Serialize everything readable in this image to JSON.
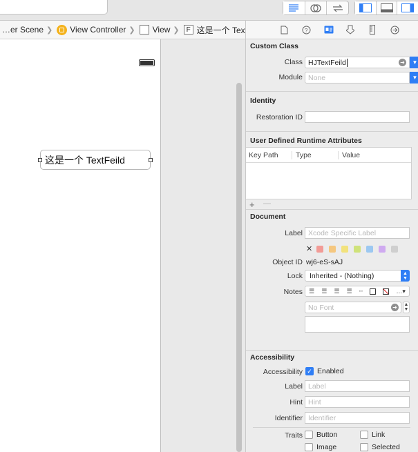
{
  "breadcrumbs": [
    {
      "label": "…er Scene"
    },
    {
      "label": "View Controller"
    },
    {
      "label": "View"
    },
    {
      "label": "这是一个 TextFeild",
      "prefix": "F"
    }
  ],
  "canvas": {
    "textfield_text": "这是一个 TextFeild"
  },
  "inspector": {
    "custom_class": {
      "title": "Custom Class",
      "class_label": "Class",
      "class_value": "HJTextFeild",
      "module_label": "Module",
      "module_value": "None"
    },
    "identity": {
      "title": "Identity",
      "restoration_label": "Restoration ID",
      "restoration_value": ""
    },
    "udra": {
      "title": "User Defined Runtime Attributes",
      "col_key": "Key Path",
      "col_type": "Type",
      "col_value": "Value",
      "add": "+",
      "remove": "—"
    },
    "document": {
      "title": "Document",
      "label_label": "Label",
      "label_placeholder": "Xcode Specific Label",
      "object_id_label": "Object ID",
      "object_id_value": "wj6-eS-sAJ",
      "lock_label": "Lock",
      "lock_value": "Inherited - (Nothing)",
      "notes_label": "Notes",
      "font_placeholder": "No Font",
      "swatches": [
        "#f29b96",
        "#f5c77f",
        "#f2e27c",
        "#cfe27a",
        "#9cc8f1",
        "#cfaaf0",
        "#cfcfcf"
      ]
    },
    "accessibility": {
      "title": "Accessibility",
      "accessibility_label": "Accessibility",
      "enabled_label": "Enabled",
      "enabled": true,
      "label_label": "Label",
      "label_placeholder": "Label",
      "hint_label": "Hint",
      "hint_placeholder": "Hint",
      "identifier_label": "Identifier",
      "identifier_placeholder": "Identifier",
      "traits_label": "Traits",
      "traits": [
        "Button",
        "Link",
        "Image",
        "Selected"
      ]
    }
  },
  "colors": {
    "accent": "#2f7ef5",
    "selected_tab": "#2f7ef5"
  }
}
